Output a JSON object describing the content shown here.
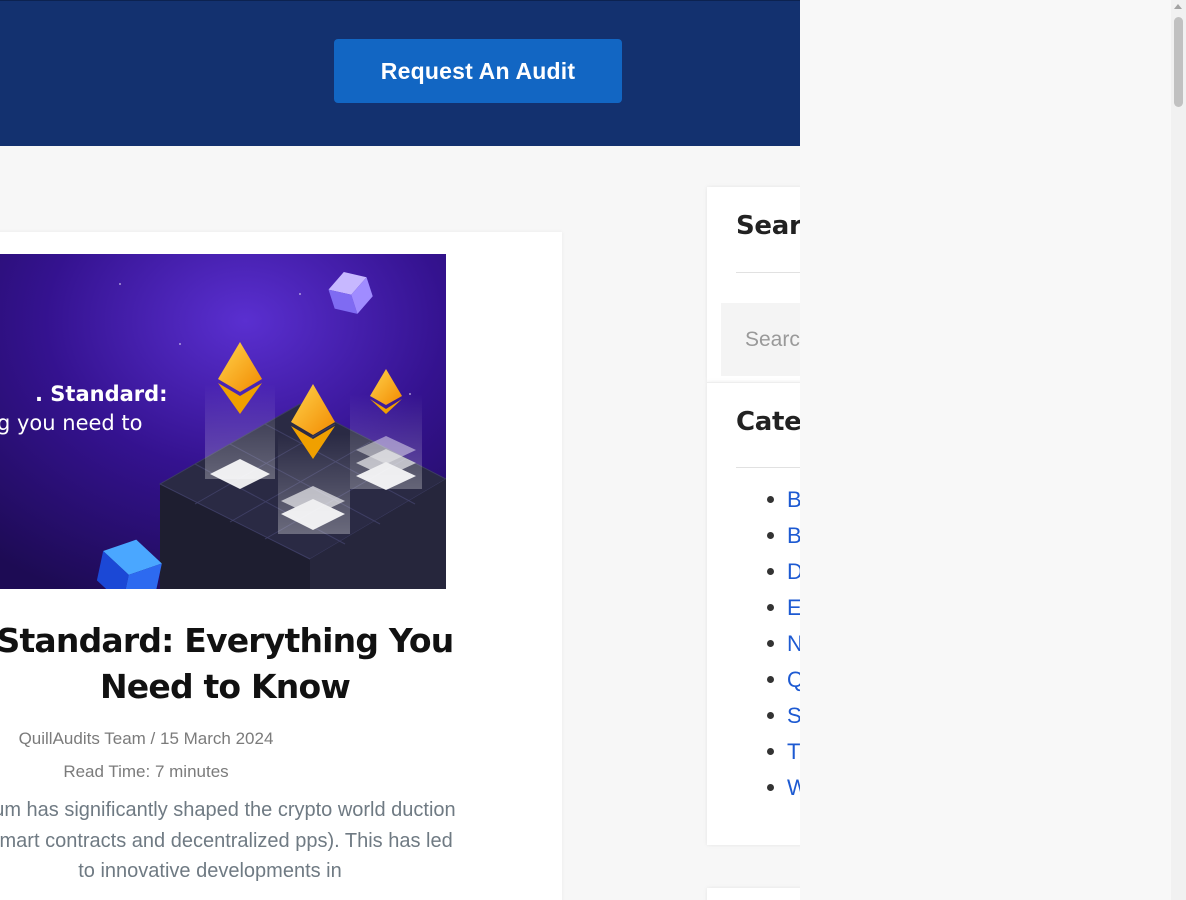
{
  "hero": {
    "cta_label": "Request An Audit"
  },
  "post": {
    "image_heading": ". Standard:",
    "image_subheading": "g you need to",
    "title": "Standard: Everything You Need to Know",
    "author": "QuillAudits Team",
    "separator": " / ",
    "date": "15 March 2024",
    "read_time": "Read Time: 7 minutes",
    "excerpt": "ereum has significantly shaped the crypto world duction of smart contracts and decentralized pps). This has led to innovative developments in"
  },
  "sidebar": {
    "search": {
      "title": "Searc",
      "placeholder": "Searc"
    },
    "categories": {
      "title": "Categ",
      "items": [
        "B",
        "B",
        "D",
        "E",
        "N",
        "Q",
        "S",
        "T",
        "W"
      ]
    }
  },
  "colors": {
    "hero_bg": "#13316f",
    "cta_bg": "#1266c3",
    "link": "#1d5ad2"
  }
}
